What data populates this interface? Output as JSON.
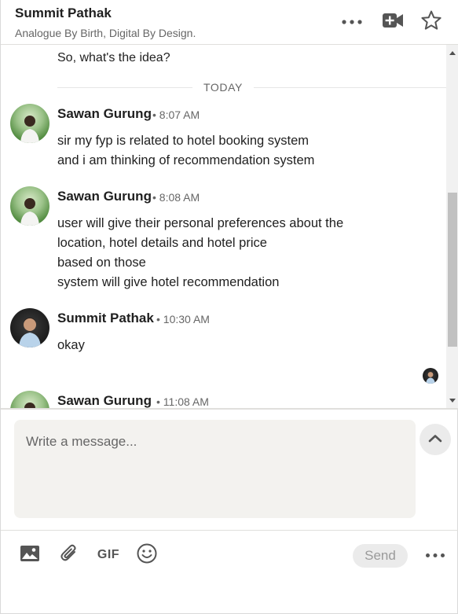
{
  "header": {
    "name": "Summit Pathak",
    "headline": "Analogue By Birth, Digital By Design.",
    "more_icon": "more-horizontal-icon",
    "video_icon": "video-call-icon",
    "star_icon": "star-icon"
  },
  "conversation": {
    "previous_message": "So, what's the idea?",
    "divider_label": "TODAY",
    "messages": [
      {
        "sender": "Sawan Gurung",
        "time": "• 8:07 AM",
        "lines": [
          "sir my fyp is related to hotel booking system",
          "and i am thinking of recommendation system"
        ]
      },
      {
        "sender": "Sawan Gurung",
        "time": "• 8:08 AM",
        "lines": [
          "user will give their personal preferences about the",
          "location, hotel details and hotel price",
          "based on those",
          "system will give hotel recommendation"
        ]
      },
      {
        "sender": "Summit Pathak",
        "time": "• 10:30 AM",
        "lines": [
          "okay"
        ]
      },
      {
        "sender": "Sawan Gurung",
        "time": "• 11:08 AM",
        "lines": []
      }
    ]
  },
  "compose": {
    "placeholder": "Write a message...",
    "gif_label": "GIF",
    "send_label": "Send"
  },
  "colors": {
    "compose_bg": "#f3f2ef",
    "text_primary": "#1f1f1f",
    "text_secondary": "#666666",
    "send_disabled_bg": "#ebebeb",
    "send_disabled_text": "#9a9a9a"
  }
}
